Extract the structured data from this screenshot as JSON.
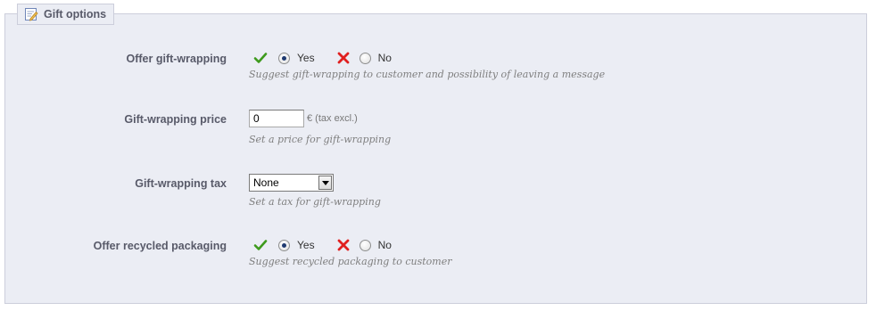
{
  "section": {
    "title": "Gift options",
    "icon": "edit-document-icon"
  },
  "gift_wrapping": {
    "label": "Offer gift-wrapping",
    "yes_label": "Yes",
    "no_label": "No",
    "selected": "Yes",
    "hint": "Suggest gift-wrapping to customer and possibility of leaving a message"
  },
  "wrapping_price": {
    "label": "Gift-wrapping price",
    "value": "0",
    "unit": "€ (tax excl.)",
    "hint": "Set a price for gift-wrapping"
  },
  "wrapping_tax": {
    "label": "Gift-wrapping tax",
    "selected": "None",
    "hint": "Set a tax for gift-wrapping"
  },
  "recycled_packaging": {
    "label": "Offer recycled packaging",
    "yes_label": "Yes",
    "no_label": "No",
    "selected": "Yes",
    "hint": "Suggest recycled packaging to customer"
  },
  "colors": {
    "panel_bg": "#ebedf4",
    "panel_border": "#cccedb",
    "label_text": "#585a69",
    "yes_icon": "#3d9a1c",
    "no_icon": "#e02020"
  }
}
